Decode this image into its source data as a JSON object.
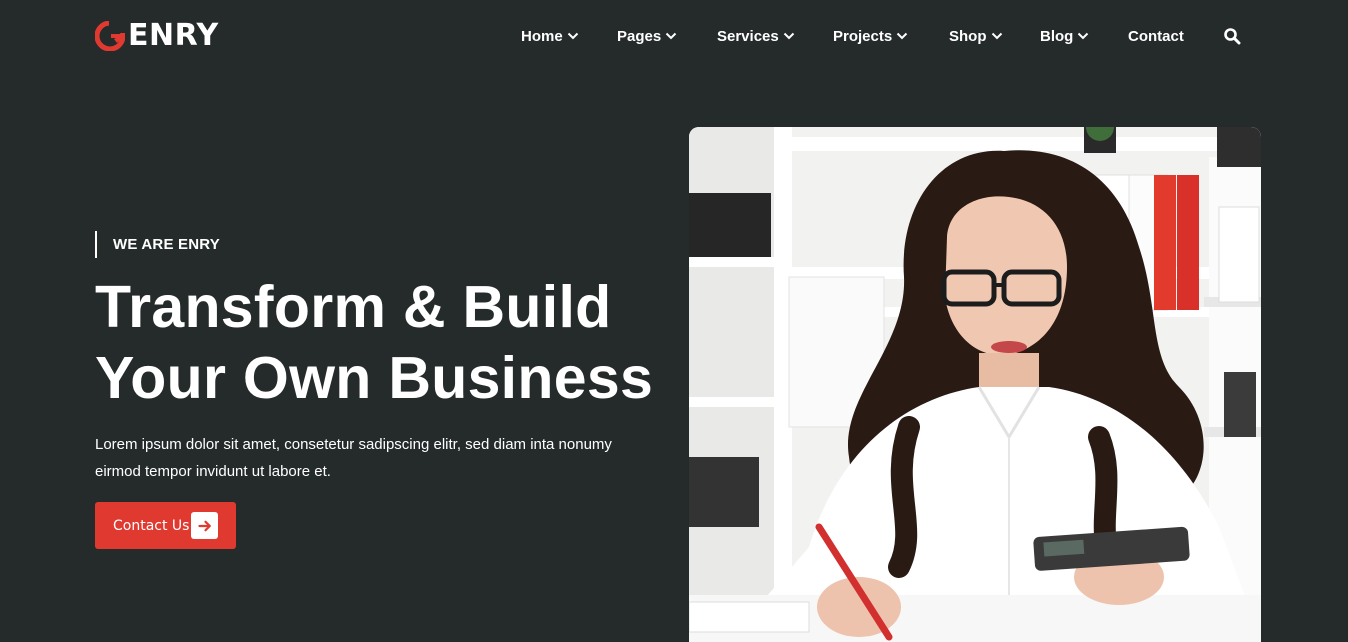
{
  "brand": {
    "logo_icon": "g-logo-icon",
    "name": "ENRY",
    "accent_color": "#e03a30"
  },
  "nav": {
    "items": [
      {
        "label": "Home",
        "has_dropdown": true
      },
      {
        "label": "Pages",
        "has_dropdown": true
      },
      {
        "label": "Services",
        "has_dropdown": true
      },
      {
        "label": "Projects",
        "has_dropdown": true
      },
      {
        "label": "Shop",
        "has_dropdown": true
      },
      {
        "label": "Blog",
        "has_dropdown": true
      },
      {
        "label": "Contact",
        "has_dropdown": false
      }
    ],
    "search_icon": "search-icon"
  },
  "hero": {
    "eyebrow": "WE ARE ENRY",
    "headline_line1": "Transform & Build",
    "headline_line2": "Your Own Business",
    "lead": "Lorem ipsum dolor sit amet, consetetur sadipscing elitr, sed diam inta nonumy eirmod tempor invidunt ut labore et.",
    "cta_label": "Contact Us",
    "cta_icon": "arrow-right-icon",
    "image_subject": "woman-at-desk-photo"
  },
  "colors": {
    "background": "#252b2b",
    "text": "#ffffff",
    "button": "#e03a30"
  }
}
